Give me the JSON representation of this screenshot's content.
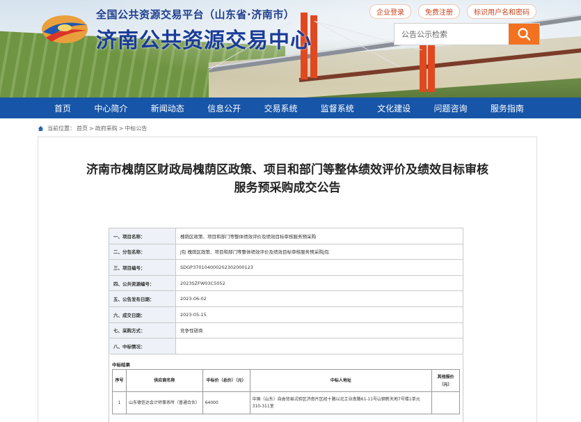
{
  "header": {
    "platform_name": "全国公共资源交易平台（山东省·济南市）",
    "site_title": "济南公共资源交易中心",
    "top_links": [
      "企业登录",
      "免费注册",
      "标识用户名和密码"
    ],
    "search": {
      "placeholder": "公告公示检索"
    }
  },
  "nav": {
    "items": [
      "首页",
      "中心简介",
      "新闻动态",
      "信息公开",
      "交易系统",
      "监督系统",
      "文化建设",
      "问题咨询",
      "服务指南"
    ]
  },
  "breadcrumb": {
    "prefix": "当前位置：",
    "items": [
      "首页",
      "政府采购",
      "中标公告"
    ],
    "separator": ">"
  },
  "announcement": {
    "title_line1": "济南市槐荫区财政局槐荫区政策、项目和部门等整体绩效评价及绩效目标审核",
    "title_line2": "服务预采购成交公告",
    "rows": [
      {
        "label": "一、项目名称：",
        "value": "槐荫区政策、项目和部门等整体绩效评价及绩效目标审核服务预采购"
      },
      {
        "label": "二、分包名称：",
        "value": "J包 槐荫区政策、项目和部门等整体绩效评价及绩效目标审核服务预采购J包"
      },
      {
        "label": "三、项目编号：",
        "value": "SDGP370104000202302000123"
      },
      {
        "label": "四、公共资源编号：",
        "value": "2023SZFW03C5052"
      },
      {
        "label": "五、公告发布日期：",
        "value": "2023-06-02"
      },
      {
        "label": "六、成交日期：",
        "value": "2023-05-15"
      },
      {
        "label": "七、采购方式：",
        "value": "竞争性磋商"
      },
      {
        "label": "八、中标情况：",
        "value": ""
      }
    ],
    "result_heading": "中标结果",
    "result_table": {
      "headers": [
        "序号",
        "供应商名称",
        "中标价（总价）（元）",
        "中标人地址",
        "其他报价（元）"
      ],
      "rows": [
        [
          "1",
          "山东德信达会计师事务所（普通合伙）",
          "64000",
          "中国（山东）自由贸易试验区济南片区经十路以北工业南路61-11号山钢新天地7号楼1单元310-311室",
          ""
        ]
      ]
    }
  }
}
